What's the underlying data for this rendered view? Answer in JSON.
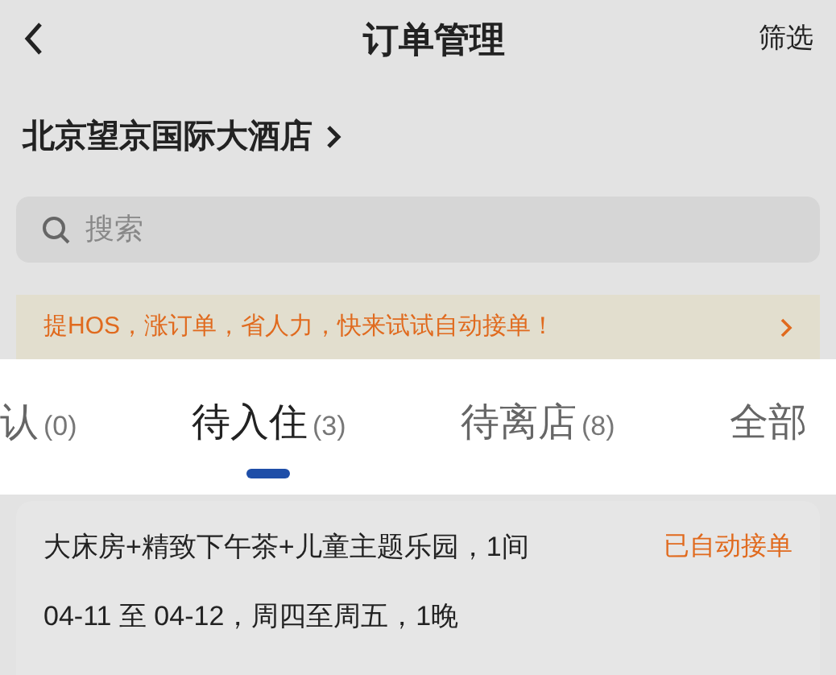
{
  "header": {
    "title": "订单管理",
    "action": "筛选"
  },
  "hotel": {
    "name": "北京望京国际大酒店"
  },
  "search": {
    "placeholder": "搜索"
  },
  "banner": {
    "text": "提HOS，涨订单，省人力，快来试试自动接单！"
  },
  "tabs": [
    {
      "label": "认",
      "count": "(0)",
      "selected": false
    },
    {
      "label": "待入住",
      "count": "(3)",
      "selected": true
    },
    {
      "label": "待离店",
      "count": "(8)",
      "selected": false
    },
    {
      "label": "全部",
      "selected": false
    }
  ],
  "orders": [
    {
      "room": "大床房+精致下午茶+儿童主题乐园，1间",
      "status": "已自动接单",
      "dates": "04-11 至 04-12，周四至周五，1晚"
    }
  ]
}
